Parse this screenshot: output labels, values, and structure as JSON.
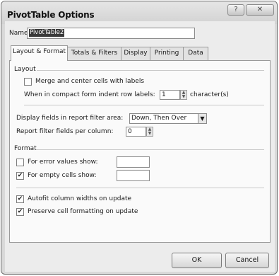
{
  "window": {
    "title": "PivotTable Options",
    "help_glyph": "?",
    "close_glyph": "✕"
  },
  "name_field": {
    "label": "Name:",
    "value": "PivotTable2"
  },
  "tabs": [
    {
      "label": "Layout & Format",
      "active": true
    },
    {
      "label": "Totals & Filters",
      "active": false
    },
    {
      "label": "Display",
      "active": false
    },
    {
      "label": "Printing",
      "active": false
    },
    {
      "label": "Data",
      "active": false
    }
  ],
  "layout_group": {
    "title": "Layout",
    "merge_center": {
      "label": "Merge and center cells with labels",
      "checked": false
    },
    "indent": {
      "label": "When in compact form indent row labels:",
      "value": "1",
      "suffix": "character(s)"
    },
    "display_fields": {
      "label": "Display fields in report filter area:",
      "value": "Down, Then Over"
    },
    "filter_fields_per_column": {
      "label": "Report filter fields per column:",
      "value": "0"
    }
  },
  "format_group": {
    "title": "Format",
    "error_values": {
      "label": "For error values show:",
      "checked": false,
      "value": ""
    },
    "empty_cells": {
      "label": "For empty cells show:",
      "checked": true,
      "value": ""
    },
    "autofit": {
      "label": "Autofit column widths on update",
      "checked": true
    },
    "preserve": {
      "label": "Preserve cell formatting on update",
      "checked": true
    }
  },
  "buttons": {
    "ok": "OK",
    "cancel": "Cancel"
  },
  "glyphs": {
    "check": "✔",
    "spin_up": "▲",
    "spin_down": "▼",
    "dropdown": "▼"
  }
}
